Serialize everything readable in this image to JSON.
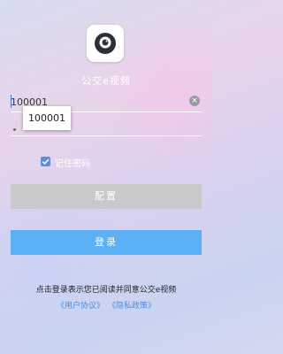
{
  "app": {
    "name": "公交e视频",
    "icon": "camera-lens-icon"
  },
  "login_form": {
    "account_value": "100001",
    "password_value": "•",
    "clear_icon": "clear-icon",
    "clear_glyph": "×",
    "suggestion": "100001",
    "remember_label": "记住密码",
    "remember_checked": true,
    "config_button": "配置",
    "login_button": "登录"
  },
  "footer": {
    "agreement_text": "点击登录表示您已阅读并同意公交e视频",
    "user_agreement_link": "《用户协议》",
    "privacy_policy_link": "《隐私政策》"
  },
  "colors": {
    "login_button": "#5bb1f4",
    "config_button": "#c9c9c9",
    "checkbox": "#5b8fd6",
    "link": "#4a8fe0"
  }
}
